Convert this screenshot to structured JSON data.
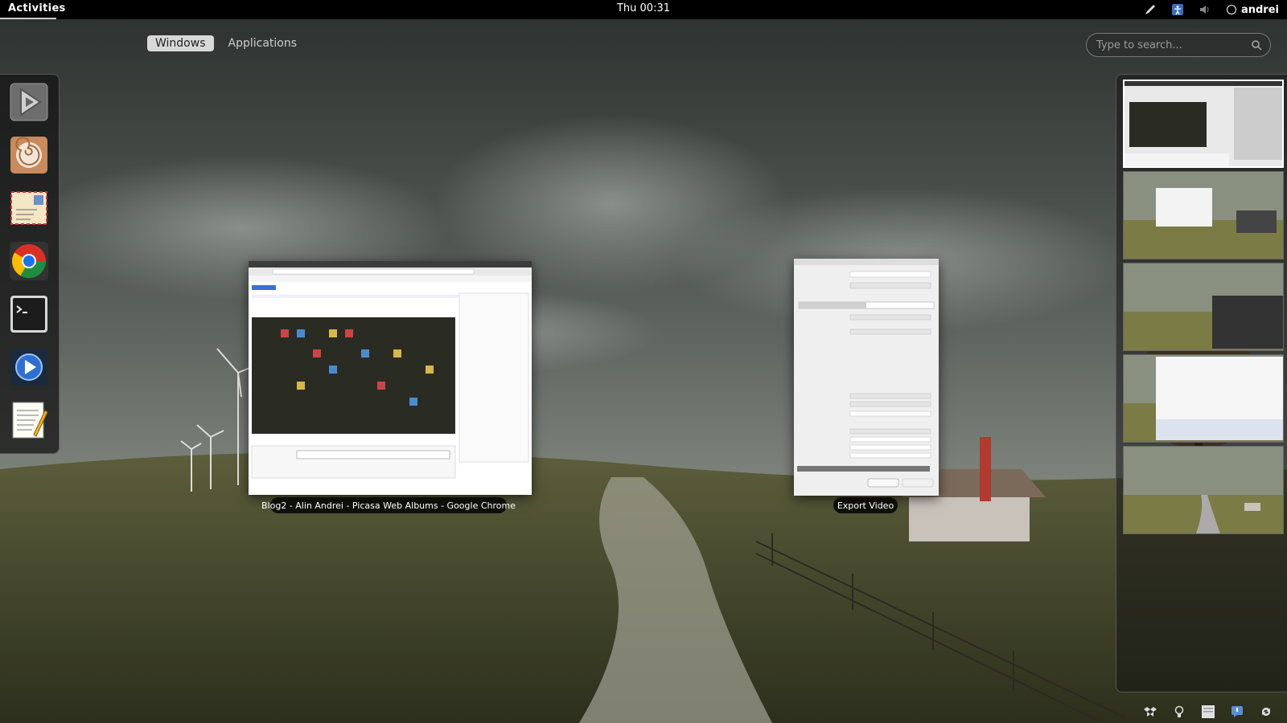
{
  "topbar": {
    "activities_label": "Activities",
    "clock": "Thu 00:31",
    "user_name": "andrei",
    "tray_icons": [
      "pen-icon",
      "accessibility-icon",
      "volume-icon",
      "user-status-icon"
    ]
  },
  "overview": {
    "tabs": [
      {
        "label": "Windows",
        "active": true
      },
      {
        "label": "Applications",
        "active": false
      }
    ],
    "search": {
      "placeholder": "Type to search..."
    }
  },
  "dash": {
    "favorites": [
      {
        "icon": "totem-play-icon"
      },
      {
        "icon": "nautilus-shell-icon"
      },
      {
        "icon": "mail-envelope-icon"
      },
      {
        "icon": "chrome-icon"
      },
      {
        "icon": "terminal-icon"
      },
      {
        "icon": "media-player-icon"
      },
      {
        "icon": "text-editor-icon"
      }
    ]
  },
  "windows": [
    {
      "caption": "Blog2 - Alin Andrei - Picasa Web Albums - Google Chrome"
    },
    {
      "caption": "Export Video"
    }
  ],
  "workspaces": {
    "count": 5,
    "active_index": 0
  },
  "message_tray": {
    "icons": [
      "dropbox-icon",
      "bulb-icon",
      "document-icon",
      "notification-icon",
      "update-icon"
    ]
  },
  "colors": {
    "topbar_bg": "#000000",
    "active_tab_bg": "#d8d8d8"
  }
}
